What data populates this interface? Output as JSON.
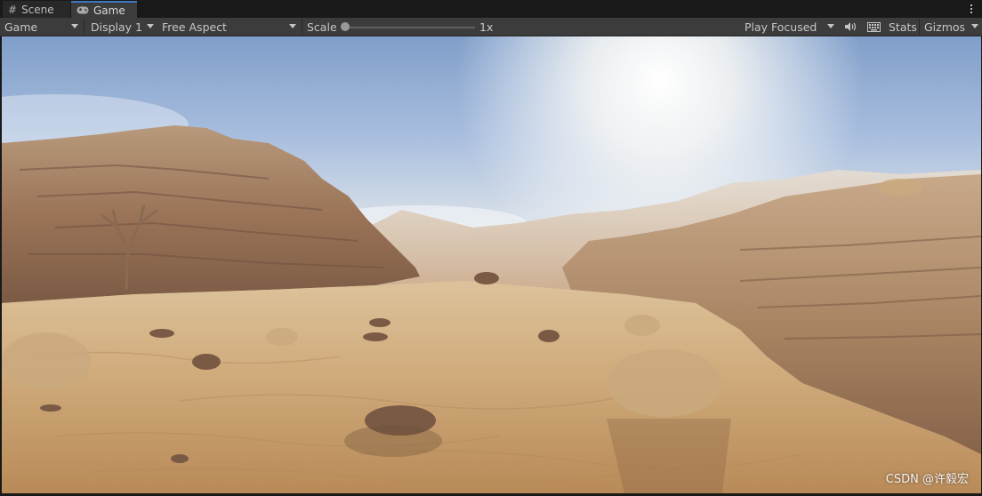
{
  "tabs": [
    {
      "icon": "grid-icon",
      "label": "Scene"
    },
    {
      "icon": "gamepad-icon",
      "label": "Game"
    }
  ],
  "toolbar": {
    "view_select": "Game",
    "display_select": "Display 1",
    "aspect_select": "Free Aspect",
    "scale_label": "Scale",
    "scale_value": "1x",
    "play_mode_select": "Play Focused",
    "stats_label": "Stats",
    "gizmos_label": "Gizmos"
  },
  "viewport": {
    "scene_description": "Desert canyon game view with sand dunes, rock formations and dry shrubs",
    "watermark": "CSDN @许毅宏"
  },
  "colors": {
    "panel_bg": "#3c3c3c",
    "tabbar_bg": "#191919",
    "active_tab_accent": "#3a79bb"
  }
}
